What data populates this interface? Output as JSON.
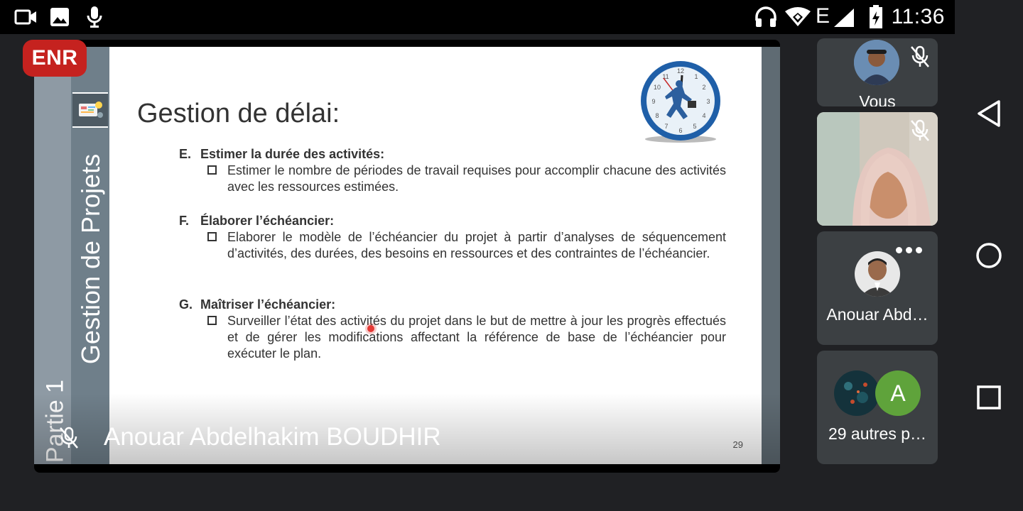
{
  "status_bar": {
    "time": "11:36",
    "network": "E",
    "icons": [
      "video-icon",
      "image-icon",
      "mic-icon",
      "headphones-icon",
      "wifi-icon",
      "signal-icon",
      "battery-icon"
    ]
  },
  "recording_badge": "ENR",
  "slide": {
    "vertical_title": "Gestion de Projets",
    "vertical_part": "Partie 1",
    "title": "Gestion de délai:",
    "sections": [
      {
        "letter": "E.",
        "heading": "Estimer la durée des activités:",
        "bullet": "Estimer le nombre de périodes de travail requises pour accomplir chacune des activités avec les ressources estimées."
      },
      {
        "letter": "F.",
        "heading": "Élaborer l’échéancier:",
        "bullet": "Elaborer le modèle de l’échéancier du projet à partir d’analyses de séquencement d’activités, des durées, des besoins en ressources et des contraintes de l’échéancier."
      },
      {
        "letter": "G.",
        "heading": "Maîtriser l’échéancier:",
        "bullet": "Surveiller l’état des activités du projet dans le but de mettre à jour les progrès effectués et de gérer les modifications affectant la référence de base de l’échéancier pour exécuter le plan."
      }
    ],
    "page_number": "29"
  },
  "main_speaker": {
    "name": "Anouar Abdelhakim BOUDHIR",
    "muted": true
  },
  "participants": [
    {
      "name": "Vous",
      "muted": true
    },
    {
      "name": "",
      "muted": true
    },
    {
      "name": "Anouar Abd…",
      "muted": false
    },
    {
      "name": "29 autres p…",
      "avatar_letter": "A",
      "avatar_color": "#5fa33b"
    }
  ],
  "colors": {
    "accent_record": "#c5221f",
    "tile_bg": "#3c4043",
    "app_bg": "#202124"
  }
}
